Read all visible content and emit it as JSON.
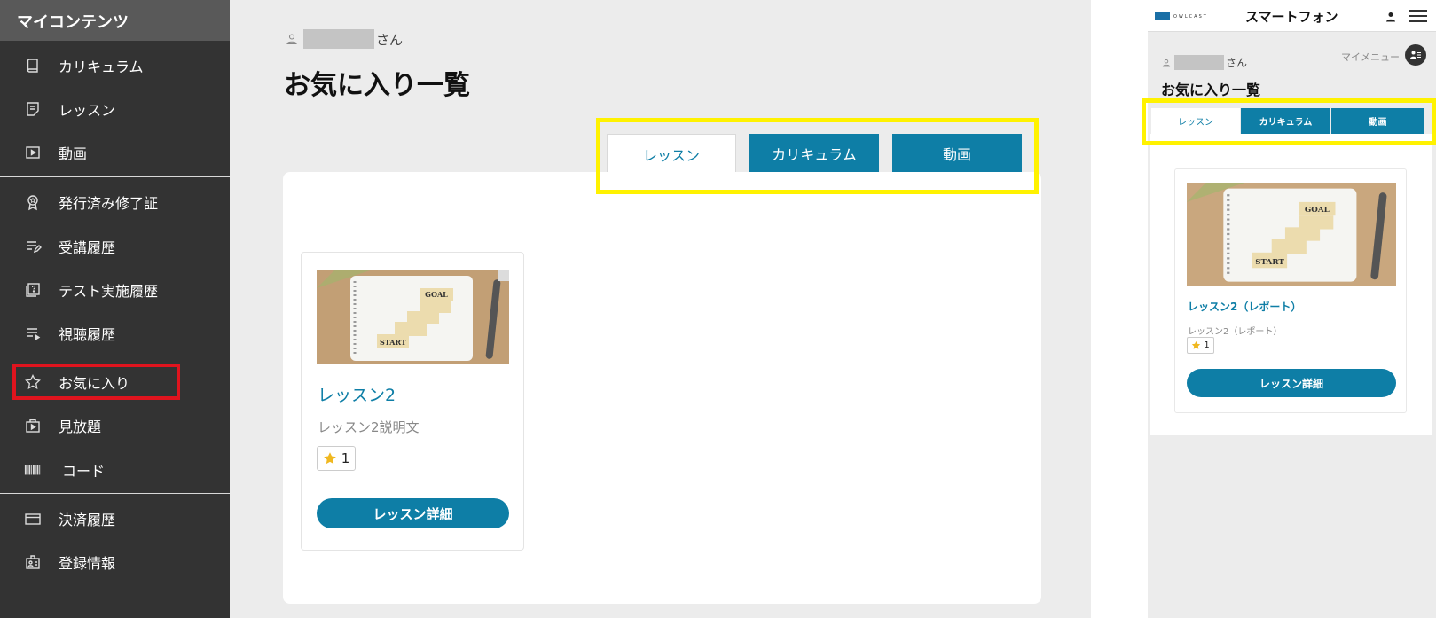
{
  "sidebar": {
    "header": "マイコンテンツ",
    "items": [
      {
        "label": "カリキュラム",
        "icon": "book-icon"
      },
      {
        "label": "レッスン",
        "icon": "note-icon"
      },
      {
        "label": "動画",
        "icon": "play-icon"
      },
      {
        "label": "発行済み修了証",
        "icon": "certificate-icon"
      },
      {
        "label": "受講履歴",
        "icon": "list-edit-icon"
      },
      {
        "label": "テスト実施履歴",
        "icon": "test-icon"
      },
      {
        "label": "視聴履歴",
        "icon": "list-play-icon"
      },
      {
        "label": "お気に入り",
        "icon": "star-icon"
      },
      {
        "label": "見放題",
        "icon": "video-folder-icon"
      },
      {
        "label": "コード",
        "icon": "barcode-icon"
      },
      {
        "label": "決済履歴",
        "icon": "card-icon"
      },
      {
        "label": "登録情報",
        "icon": "id-card-icon"
      }
    ]
  },
  "main": {
    "user_suffix": "さん",
    "title": "お気に入り一覧",
    "tabs": [
      {
        "label": "レッスン",
        "active": true
      },
      {
        "label": "カリキュラム",
        "active": false
      },
      {
        "label": "動画",
        "active": false
      }
    ],
    "card": {
      "title": "レッスン2",
      "description": "レッスン2説明文",
      "favorite_count": "1",
      "button": "レッスン詳細",
      "thumb_goal": "GOAL",
      "thumb_start": "START"
    }
  },
  "phone": {
    "logo_text": "OWLCAST",
    "header_title": "スマートフォン",
    "my_menu": "マイメニュー",
    "user_suffix": "さん",
    "title": "お気に入り一覧",
    "tabs": [
      {
        "label": "レッスン",
        "active": true
      },
      {
        "label": "カリキュラム",
        "active": false
      },
      {
        "label": "動画",
        "active": false
      }
    ],
    "card": {
      "title": "レッスン2（レポート）",
      "description": "レッスン2（レポート）",
      "favorite_count": "1",
      "button": "レッスン詳細",
      "thumb_goal": "GOAL",
      "thumb_start": "START"
    }
  },
  "colors": {
    "accent": "#0e7ea6",
    "sidebar_bg": "#333333",
    "highlight_yellow": "#fff200",
    "highlight_red": "#e0141e",
    "star": "#f0b820"
  }
}
